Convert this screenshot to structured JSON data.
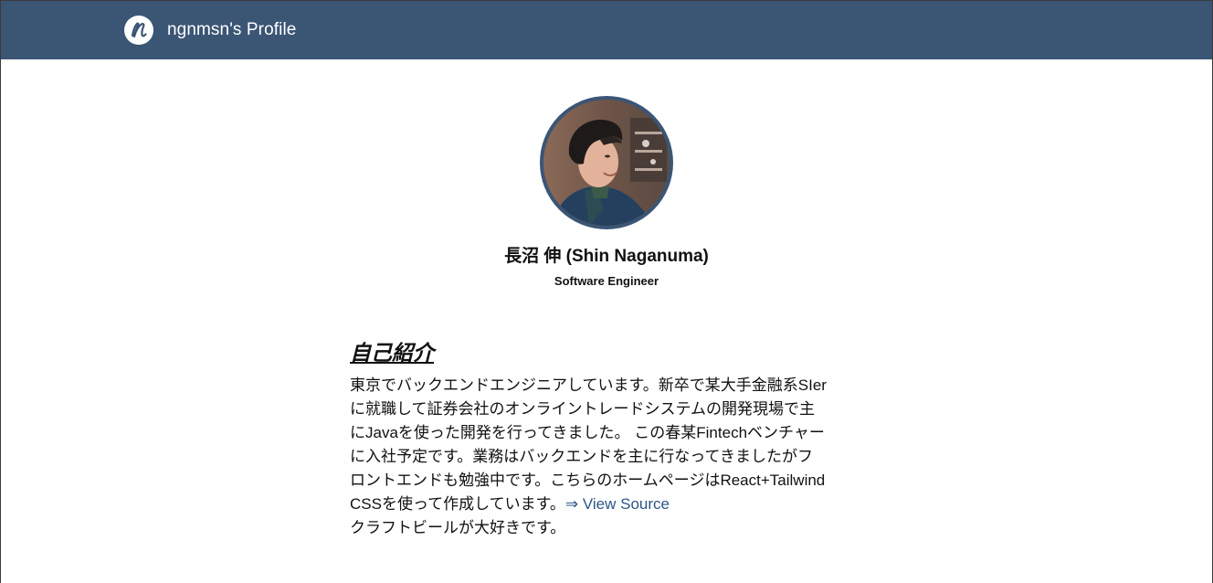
{
  "header": {
    "logo_letter": "n",
    "title": "ngnmsn's Profile"
  },
  "profile": {
    "avatar_alt": "avatar",
    "name": "長沼 伸 (Shin Naganuma)",
    "role": "Software Engineer"
  },
  "about": {
    "heading": "自己紹介",
    "paragraph_lines": [
      "東京でバックエンドエンジニアしています。新卒で某大手金融系SIer",
      "に就職して証券会社のオンライントレードシステムの開発現場で主",
      "にJavaを使った開発を行ってきました。 この春某Fintechベンチャー",
      "に入社予定です。業務はバックエンドを主に行なってきましたがフ",
      "ロントエンドも勉強中です。こちらのホームページはReact+Tailwind",
      "CSSを使って作成しています。"
    ],
    "source_link": "⇒ View Source",
    "closing": "クラフトビールが大好きです。"
  },
  "colors": {
    "navbar": "#3b5575",
    "link": "#2d5585",
    "avatar_border": "#3b5575"
  },
  "icons": {
    "logo": "cursive-n-logo-icon"
  }
}
